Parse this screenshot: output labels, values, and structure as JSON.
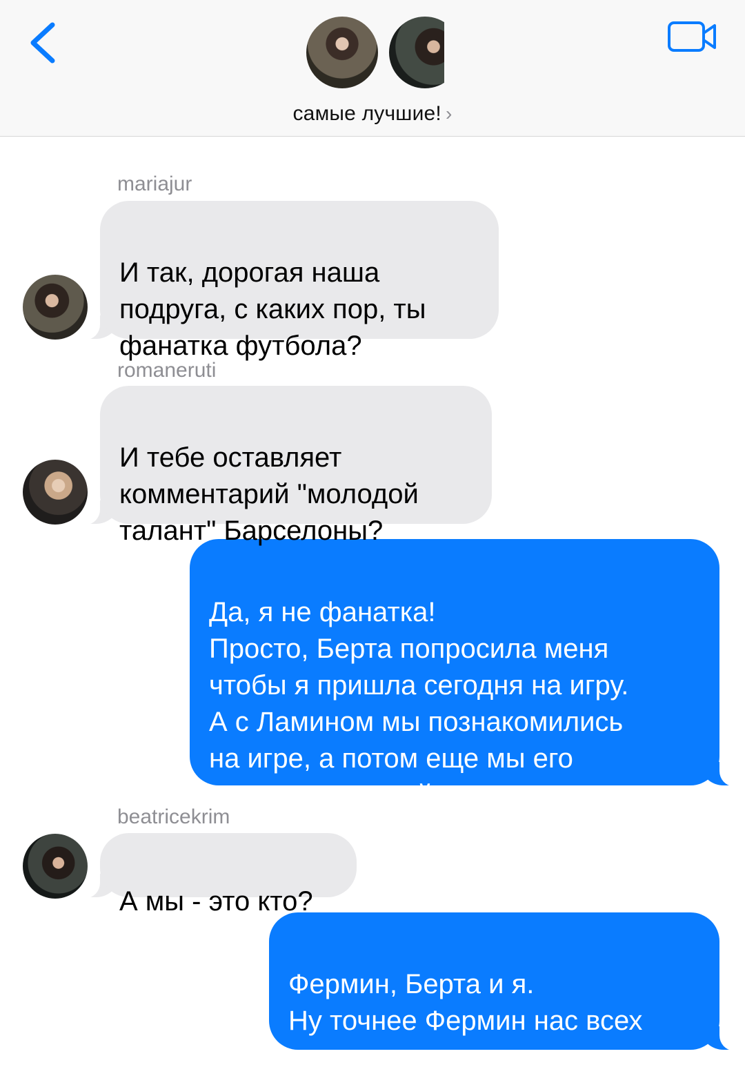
{
  "header": {
    "group_name": "самые лучшие!",
    "chevron": "›",
    "accent_color": "#0a7cff"
  },
  "messages": [
    {
      "sender": "mariajur",
      "direction": "incoming",
      "text": "И так, дорогая наша\nподруга, с каких пор, ты\nфанатка футбола?"
    },
    {
      "sender": "romaneruti",
      "direction": "incoming",
      "text": "И тебе оставляет\nкомментарий \"молодой\nталант\" Барселоны?"
    },
    {
      "sender": "",
      "direction": "outgoing",
      "text": "Да, я не фанатка!\nПросто, Берта попросила меня\nчтобы я пришла сегодня на игру.\nА с Ламином мы познакомились\nна игре, а потом еще мы его\nподвозили домой."
    },
    {
      "sender": "beatricekrim",
      "direction": "incoming",
      "text": "А мы - это кто?"
    },
    {
      "sender": "",
      "direction": "outgoing",
      "text": "Фермин, Берта и я.\nНу точнее Фермин нас всех\nподвозил."
    }
  ],
  "icons": {
    "back": "chevron-left-icon",
    "video": "video-camera-icon"
  }
}
